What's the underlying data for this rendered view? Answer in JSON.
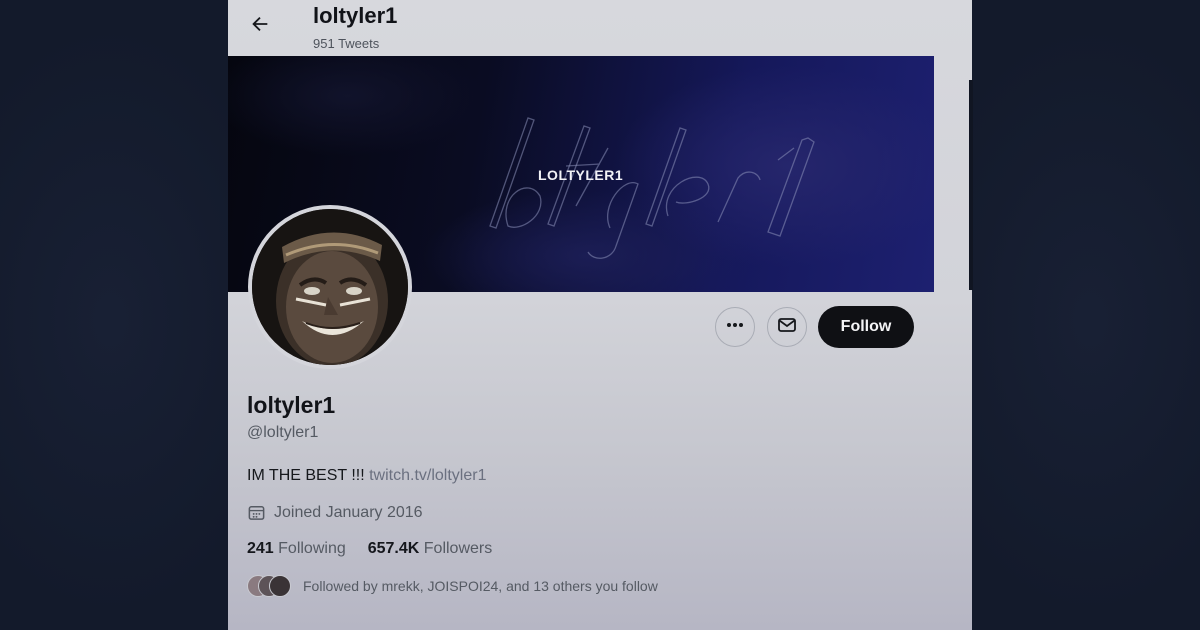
{
  "header": {
    "back_icon": "arrow-left-icon",
    "name": "loltyler1",
    "tweet_count": "951 Tweets"
  },
  "banner": {
    "text": "LOLTYLER1"
  },
  "profile": {
    "display_name": "loltyler1",
    "handle": "@loltyler1",
    "bio_text": "IM THE BEST !!! ",
    "bio_link": "twitch.tv/loltyler1",
    "joined_icon": "calendar-icon",
    "joined": "Joined January 2016",
    "following_count": "241",
    "following_label": " Following",
    "followers_count": "657.4K",
    "followers_label": " Followers",
    "followed_by": "Followed by mrekk, JOISPOI24, and 13 others you follow"
  },
  "actions": {
    "more_icon": "more-icon",
    "message_icon": "mail-icon",
    "follow_label": "Follow"
  },
  "colors": {
    "page_background": "#131a2b",
    "panel": "#d4d5db",
    "follow_button": "#0f1014",
    "link": "#6b7080"
  }
}
